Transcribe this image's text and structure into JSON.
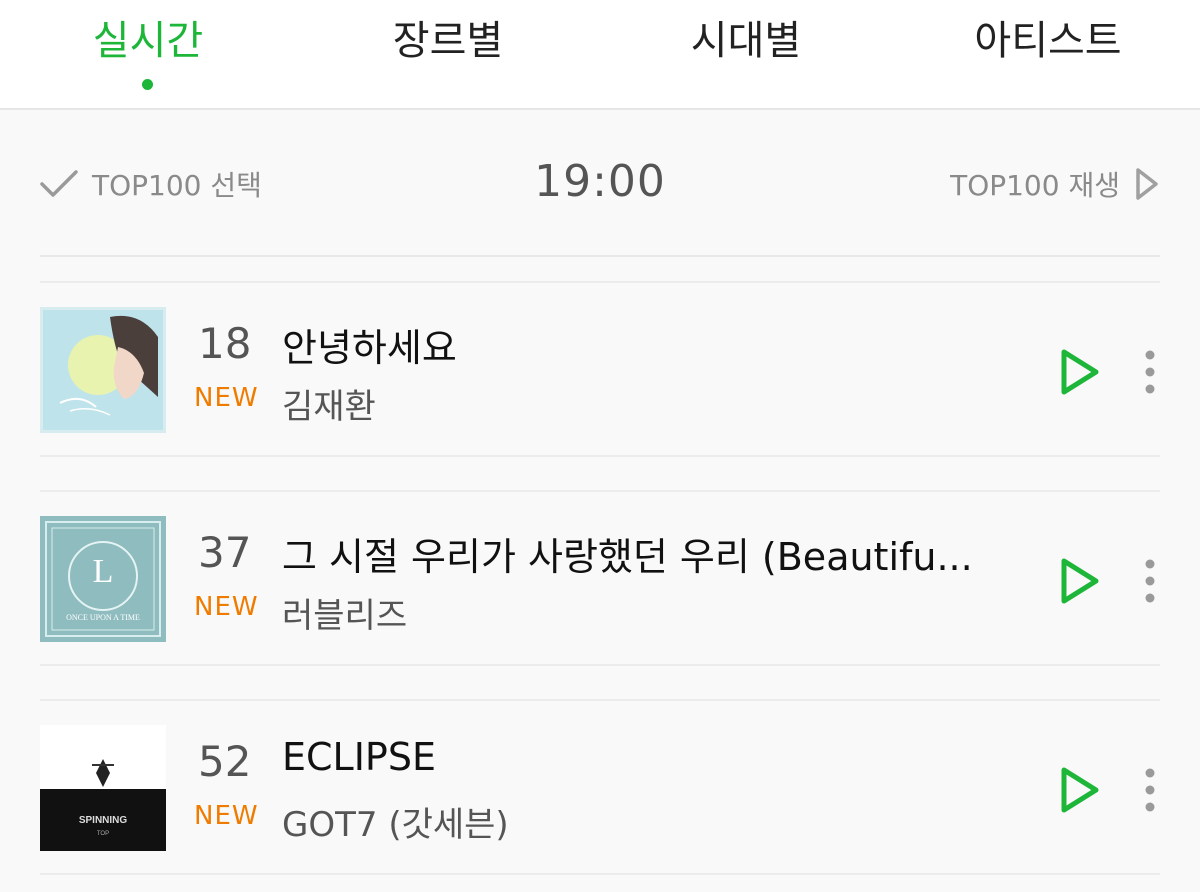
{
  "tabs": [
    {
      "label": "실시간",
      "active": true
    },
    {
      "label": "장르별",
      "active": false
    },
    {
      "label": "시대별",
      "active": false
    },
    {
      "label": "아티스트",
      "active": false
    }
  ],
  "toolbar": {
    "select_label": "TOP100 선택",
    "time": "19:00",
    "play_label": "TOP100 재생"
  },
  "songs": [
    {
      "rank": "18",
      "title": "안녕하세요",
      "badge": "NEW",
      "artist": "김재환",
      "art_icon": "album-art-light-blue"
    },
    {
      "rank": "37",
      "title": "그 시절 우리가 사랑했던 우리 (Beautifu...",
      "badge": "NEW",
      "artist": "러블리즈",
      "art_icon": "album-art-teal-ornate"
    },
    {
      "rank": "52",
      "title": "ECLIPSE",
      "badge": "NEW",
      "artist": "GOT7 (갓세븐)",
      "art_icon": "album-art-black-white"
    }
  ],
  "colors": {
    "accent": "#1db639",
    "new_badge": "#ef7c00",
    "muted": "#8a8a8a"
  }
}
